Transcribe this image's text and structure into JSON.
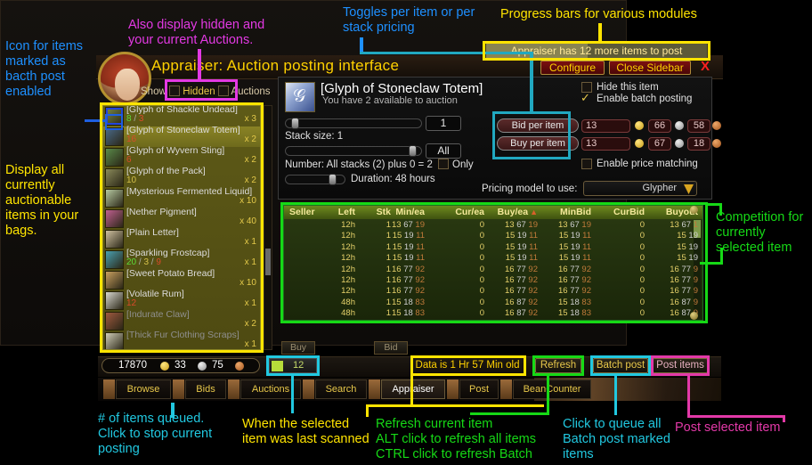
{
  "window": {
    "title": "Appraiser: Auction posting interface",
    "configure_label": "Configure",
    "close_sidebar_label": "Close Sidebar",
    "close_label": "X",
    "progress_text": "Appraiser has 12 more items to post",
    "progress_percent": 46
  },
  "filters": {
    "show_label": "Show",
    "hidden_label": "Hidden",
    "auctions_label": "Auctions"
  },
  "item_list": [
    {
      "name": "[Glyph of Shackle Undead]",
      "sub": "8 / 3",
      "sub_colors": [
        "#5ddb3a",
        "#d94a2a"
      ],
      "qty": "x 3",
      "selected": false,
      "dim": false,
      "batch": true,
      "icon": "#7a8a4a"
    },
    {
      "name": "[Glyph of Stoneclaw Totem]",
      "sub": "16",
      "sub_colors": [
        "#d94a2a"
      ],
      "qty": "x 2",
      "selected": true,
      "dim": false,
      "batch": false,
      "icon": "#4a6a8a"
    },
    {
      "name": "[Glyph of Wyvern Sting]",
      "sub": "6",
      "sub_colors": [
        "#d94a2a"
      ],
      "qty": "x 2",
      "selected": false,
      "dim": false,
      "batch": false,
      "icon": "#5a8a4a"
    },
    {
      "name": "[Glyph of the Pack]",
      "sub": "10",
      "sub_colors": [
        "#d4c04a"
      ],
      "qty": "x 2",
      "selected": false,
      "dim": false,
      "batch": false,
      "icon": "#8a8a5a"
    },
    {
      "name": "[Mysterious Fermented Liquid]",
      "sub": "",
      "sub_colors": [],
      "qty": "x 10",
      "selected": false,
      "dim": false,
      "batch": false,
      "icon": "#b5c8a0"
    },
    {
      "name": "[Nether Pigment]",
      "sub": "",
      "sub_colors": [],
      "qty": "x 40",
      "selected": false,
      "dim": false,
      "batch": false,
      "icon": "#c06090"
    },
    {
      "name": "[Plain Letter]",
      "sub": "",
      "sub_colors": [],
      "qty": "x 1",
      "selected": false,
      "dim": false,
      "batch": false,
      "icon": "#cfc0a0"
    },
    {
      "name": "[Sparkling Frostcap]",
      "sub": "20 / 3 / 9",
      "sub_colors": [
        "#5ddb3a",
        "#d4c04a",
        "#d94a2a"
      ],
      "qty": "x 1",
      "selected": false,
      "dim": false,
      "batch": false,
      "icon": "#4aa0b0"
    },
    {
      "name": "[Sweet Potato Bread]",
      "sub": "",
      "sub_colors": [],
      "qty": "x 10",
      "selected": false,
      "dim": false,
      "batch": false,
      "icon": "#c9a060"
    },
    {
      "name": "[Volatile Rum]",
      "sub": "12",
      "sub_colors": [
        "#d94a2a"
      ],
      "qty": "x 1",
      "selected": false,
      "dim": false,
      "batch": false,
      "icon": "#d8d8d0"
    },
    {
      "name": "[Indurate Claw]",
      "sub": "",
      "sub_colors": [],
      "qty": "x 2",
      "selected": false,
      "dim": true,
      "batch": false,
      "icon": "#a05a40"
    },
    {
      "name": "[Thick Fur Clothing Scraps]",
      "sub": "",
      "sub_colors": [],
      "qty": "x 1",
      "selected": false,
      "dim": true,
      "batch": false,
      "icon": "#d0cdb8"
    }
  ],
  "detail": {
    "item_name": "[Glyph of Stoneclaw Totem]",
    "available_text": "You have 2 available to auction",
    "stack_value": "1",
    "stack_label": "Stack size: 1",
    "number_value": "All",
    "number_label": "Number: All stacks (2) plus 0 = 2",
    "only_label": "Only",
    "duration_label": "Duration: 48 hours",
    "hide_item_label": "Hide this item",
    "enable_batch_label": "Enable batch posting",
    "bid_per_item_label": "Bid per item",
    "buy_per_item_label": "Buy per item",
    "bid_gold": "13",
    "bid_silver": "66",
    "bid_copper": "58",
    "buy_gold": "13",
    "buy_silver": "67",
    "buy_copper": "18",
    "price_matching_label": "Enable price matching",
    "pricing_model_label": "Pricing model to use:",
    "pricing_model_value": "Glypher"
  },
  "table": {
    "columns": [
      "Seller",
      "Left",
      "Stk",
      "Min/ea",
      "Cur/ea",
      "Buy/ea",
      "MinBid",
      "CurBid",
      "Buyout"
    ],
    "sort_column": "Buy/ea",
    "rows": [
      {
        "seller": "",
        "left": "12h",
        "stk": "1",
        "minea": [
          "13",
          "67",
          "19"
        ],
        "curea": "0",
        "buyea": [
          "13",
          "67",
          "19"
        ],
        "minbid": [
          "13",
          "67",
          "19"
        ],
        "curbid": "0",
        "buyout": [
          "13",
          "67",
          "1"
        ]
      },
      {
        "seller": "",
        "left": "12h",
        "stk": "1",
        "minea": [
          "15",
          "19",
          "11"
        ],
        "curea": "0",
        "buyea": [
          "15",
          "19",
          "11"
        ],
        "minbid": [
          "15",
          "19",
          "11"
        ],
        "curbid": "0",
        "buyout": [
          "15",
          "19",
          ""
        ]
      },
      {
        "seller": "",
        "left": "12h",
        "stk": "1",
        "minea": [
          "15",
          "19",
          "11"
        ],
        "curea": "0",
        "buyea": [
          "15",
          "19",
          "11"
        ],
        "minbid": [
          "15",
          "19",
          "11"
        ],
        "curbid": "0",
        "buyout": [
          "15",
          "19",
          ""
        ]
      },
      {
        "seller": "",
        "left": "12h",
        "stk": "1",
        "minea": [
          "15",
          "19",
          "11"
        ],
        "curea": "0",
        "buyea": [
          "15",
          "19",
          "11"
        ],
        "minbid": [
          "15",
          "19",
          "11"
        ],
        "curbid": "0",
        "buyout": [
          "15",
          "19",
          ""
        ]
      },
      {
        "seller": "",
        "left": "12h",
        "stk": "1",
        "minea": [
          "16",
          "77",
          "92"
        ],
        "curea": "0",
        "buyea": [
          "16",
          "77",
          "92"
        ],
        "minbid": [
          "16",
          "77",
          "92"
        ],
        "curbid": "0",
        "buyout": [
          "16",
          "77",
          "9"
        ]
      },
      {
        "seller": "",
        "left": "12h",
        "stk": "1",
        "minea": [
          "16",
          "77",
          "92"
        ],
        "curea": "0",
        "buyea": [
          "16",
          "77",
          "92"
        ],
        "minbid": [
          "16",
          "77",
          "92"
        ],
        "curbid": "0",
        "buyout": [
          "16",
          "77",
          "9"
        ]
      },
      {
        "seller": "",
        "left": "12h",
        "stk": "1",
        "minea": [
          "16",
          "77",
          "92"
        ],
        "curea": "0",
        "buyea": [
          "16",
          "77",
          "92"
        ],
        "minbid": [
          "16",
          "77",
          "92"
        ],
        "curbid": "0",
        "buyout": [
          "16",
          "77",
          "9"
        ]
      },
      {
        "seller": "",
        "left": "48h",
        "stk": "1",
        "minea": [
          "15",
          "18",
          "83"
        ],
        "curea": "0",
        "buyea": [
          "16",
          "87",
          "92"
        ],
        "minbid": [
          "15",
          "18",
          "83"
        ],
        "curbid": "0",
        "buyout": [
          "16",
          "87",
          "9"
        ]
      },
      {
        "seller": "",
        "left": "48h",
        "stk": "1",
        "minea": [
          "15",
          "18",
          "83"
        ],
        "curea": "0",
        "buyea": [
          "16",
          "87",
          "92"
        ],
        "minbid": [
          "15",
          "18",
          "83"
        ],
        "curbid": "0",
        "buyout": [
          "16",
          "87",
          "9"
        ]
      }
    ]
  },
  "trade_buttons": {
    "buy": "Buy",
    "bid": "Bid"
  },
  "statusbar": {
    "money_gold": "17870",
    "money_silver": "33",
    "money_copper": "75",
    "queue_count": "12",
    "data_age": "Data is 1 Hr 57 Min old",
    "refresh_label": "Refresh",
    "batch_post_label": "Batch post",
    "post_items_label": "Post items"
  },
  "tabs": [
    {
      "label": "Browse",
      "active": false
    },
    {
      "label": "Bids",
      "active": false
    },
    {
      "label": "Auctions",
      "active": false
    },
    {
      "label": "Search",
      "active": false
    },
    {
      "label": "Appraiser",
      "active": true
    },
    {
      "label": "Post",
      "active": false
    },
    {
      "label": "BeanCounter",
      "active": false
    }
  ],
  "annotations": {
    "icon_batch": "Icon for items\nmarked as\nbacth post\nenabled",
    "hidden_auctions": "Also display hidden and\nyour current Auctions.",
    "toggles_pricing": "Toggles per item or per\nstack pricing",
    "progress_bars": "Progress bars for various modules",
    "display_all": "Display all\ncurrently\nauctionable\nitems in your\nbags.",
    "competition": "Competition for\ncurrently\nselected item",
    "queued": "# of items queued.\nClick to stop current\nposting",
    "last_scanned": "When the selected\nitem was last scanned",
    "refresh": "Refresh current item\nALT click to refresh all items\nCTRL click to refresh Batch",
    "queue_all": "Click to queue all\nBatch post marked\nitems",
    "post_selected": "Post selected item"
  },
  "colors": {
    "blue": "#1e90ff",
    "yellow": "#ffe400",
    "magenta": "#e339e3",
    "green": "#16d916",
    "cyan": "#21c8e0",
    "pink": "#e339a8"
  }
}
